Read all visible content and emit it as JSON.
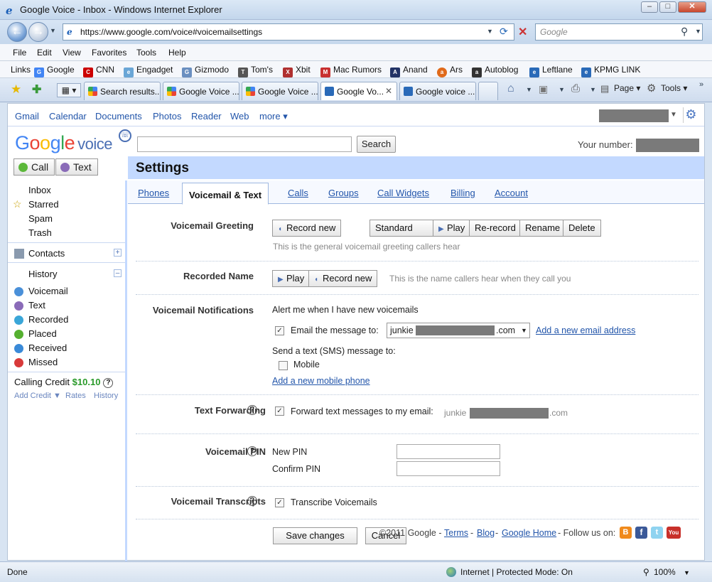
{
  "window": {
    "title": "Google Voice - Inbox - Windows Internet Explorer",
    "url": "https://www.google.com/voice#voicemailsettings",
    "search_placeholder": "Google"
  },
  "menu": [
    "File",
    "Edit",
    "View",
    "Favorites",
    "Tools",
    "Help"
  ],
  "links_bar": {
    "label": "Links",
    "items": [
      {
        "label": "Google",
        "color": "#4285f4"
      },
      {
        "label": "CNN",
        "color": "#cc0000"
      },
      {
        "label": "Engadget",
        "color": "#6aa6d6"
      },
      {
        "label": "Gizmodo",
        "color": "#6a8fc0"
      },
      {
        "label": "Tom's",
        "color": "#555555"
      },
      {
        "label": "Xbit",
        "color": "#b03030"
      },
      {
        "label": "Mac Rumors",
        "color": "#c83030"
      },
      {
        "label": "Anand",
        "color": "#223366"
      },
      {
        "label": "Ars",
        "color": "#e06a1b"
      },
      {
        "label": "Autoblog",
        "color": "#333333"
      },
      {
        "label": "Leftlane",
        "color": "#2a6ab8"
      },
      {
        "label": "KPMG LINK",
        "color": "#2a6ab8"
      }
    ]
  },
  "tabs": [
    "Search results...",
    "Google Voice ...",
    "Google Voice ...",
    "Google Vo...",
    "Google voice ..."
  ],
  "command_bar": {
    "page": "Page",
    "tools": "Tools"
  },
  "gbar": [
    "Gmail",
    "Calendar",
    "Documents",
    "Photos",
    "Reader",
    "Web",
    "more"
  ],
  "header": {
    "logo_google": "Google",
    "logo_voice": "voice",
    "search_button": "Search",
    "your_number_label": "Your number:",
    "settings_title": "Settings",
    "call_button": "Call",
    "text_button": "Text"
  },
  "sidebar": {
    "folders": [
      "Inbox",
      "Starred",
      "Spam",
      "Trash"
    ],
    "contacts": "Contacts",
    "history": "History",
    "history_items": [
      {
        "label": "Voicemail",
        "color": "#4a90d9"
      },
      {
        "label": "Text",
        "color": "#8a6bb8"
      },
      {
        "label": "Recorded",
        "color": "#3aa6d8"
      },
      {
        "label": "Placed",
        "color": "#55b030"
      },
      {
        "label": "Received",
        "color": "#3a8ad8"
      },
      {
        "label": "Missed",
        "color": "#d83a3a"
      }
    ],
    "credit_label": "Calling Credit",
    "credit_value": "$10.10",
    "add_credit": "Add Credit ▼",
    "rates": "Rates",
    "history_link": "History"
  },
  "settings_tabs": [
    "Phones",
    "Voicemail & Text",
    "Calls",
    "Groups",
    "Call Widgets",
    "Billing",
    "Account"
  ],
  "greeting": {
    "label": "Voicemail Greeting",
    "record_new": "Record new",
    "selected": "Standard",
    "play": "Play",
    "rerecord": "Re-record",
    "rename": "Rename",
    "delete": "Delete",
    "hint": "This is the general voicemail greeting callers hear"
  },
  "recorded_name": {
    "label": "Recorded Name",
    "play": "Play",
    "record_new": "Record new",
    "hint": "This is the name callers hear when they call you"
  },
  "notifications": {
    "label": "Voicemail Notifications",
    "alert": "Alert me when I have new voicemails",
    "email_label": "Email the message to:",
    "email_prefix": "junkie",
    "email_suffix": ".com",
    "add_email": "Add a new email address",
    "sms_label": "Send a text (SMS) message to:",
    "mobile": "Mobile",
    "add_mobile": "Add a new mobile phone"
  },
  "forwarding": {
    "label": "Text Forwarding",
    "text": "Forward text messages to my email:",
    "email_prefix": "junkie",
    "email_suffix": ".com"
  },
  "pin": {
    "label": "Voicemail PIN",
    "new": "New PIN",
    "confirm": "Confirm PIN"
  },
  "transcripts": {
    "label": "Voicemail Transcripts",
    "text": "Transcribe Voicemails"
  },
  "footer": {
    "save": "Save changes",
    "cancel": "Cancel",
    "copyright": "©2011 Google -",
    "terms": "Terms",
    "blog": "Blog",
    "home": "Google Home",
    "follow": "- Follow us on:"
  },
  "status": {
    "done": "Done",
    "zone": "Internet | Protected Mode: On",
    "zoom": "100%"
  }
}
